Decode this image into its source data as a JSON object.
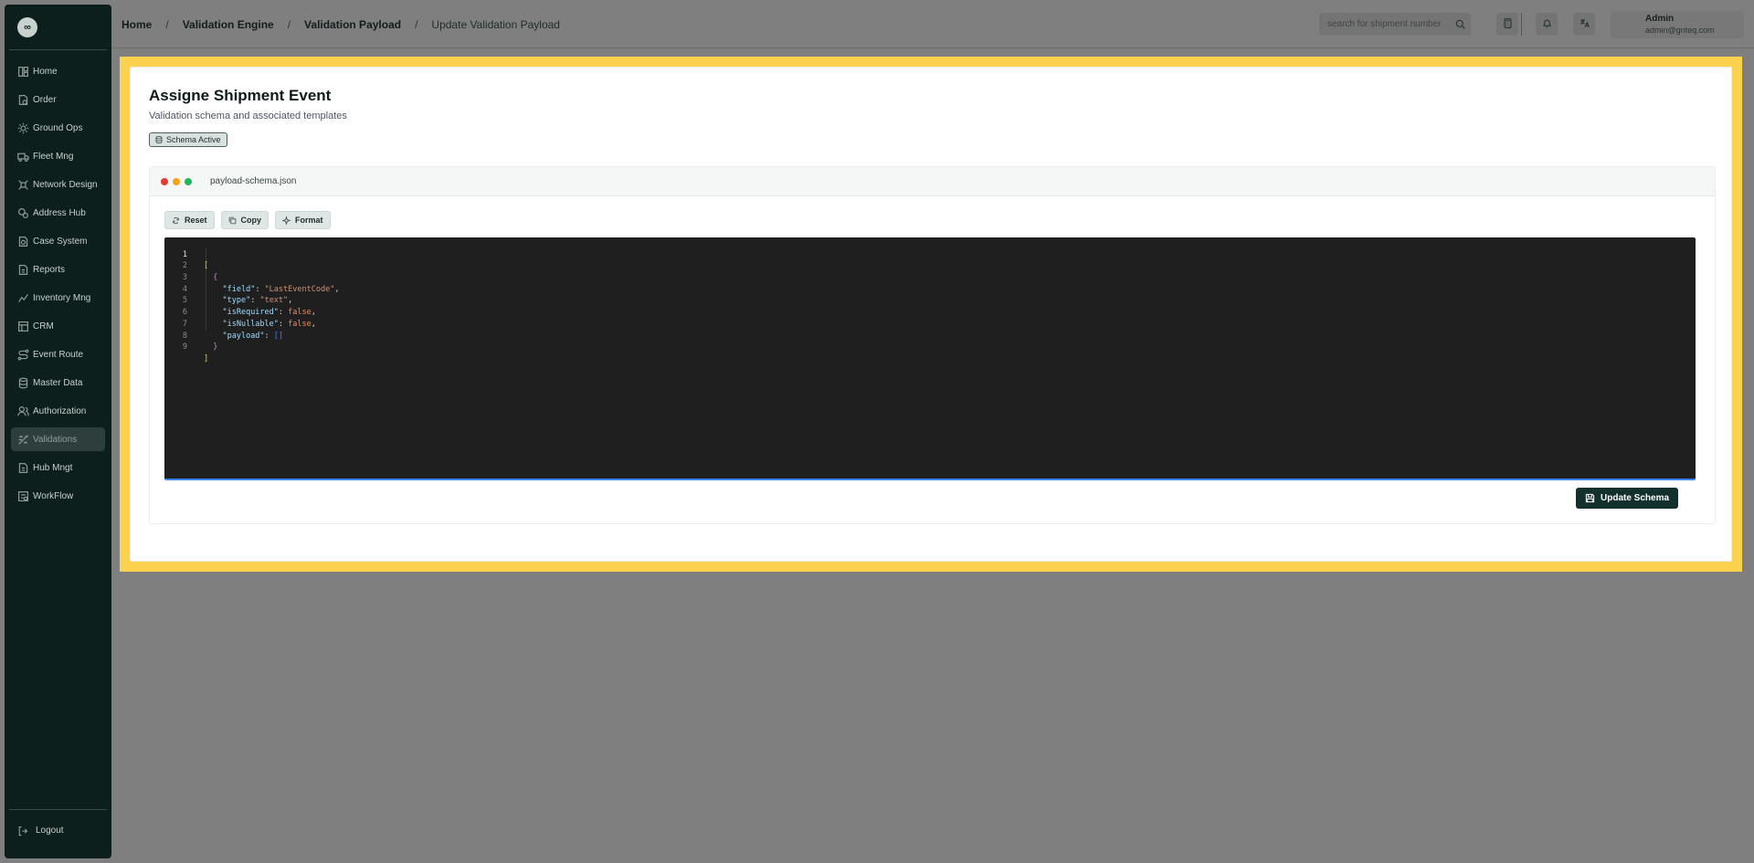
{
  "sidebar": {
    "logo_text": "∞",
    "items": [
      {
        "label": "Home",
        "icon": "dashboard-icon"
      },
      {
        "label": "Order",
        "icon": "order-icon"
      },
      {
        "label": "Ground Ops",
        "icon": "ground-ops-icon"
      },
      {
        "label": "Fleet Mng",
        "icon": "truck-icon"
      },
      {
        "label": "Network Design",
        "icon": "network-icon"
      },
      {
        "label": "Address Hub",
        "icon": "map-pin-icon"
      },
      {
        "label": "Case System",
        "icon": "case-icon"
      },
      {
        "label": "Reports",
        "icon": "reports-icon"
      },
      {
        "label": "Inventory Mng",
        "icon": "inventory-icon"
      },
      {
        "label": "CRM",
        "icon": "crm-icon"
      },
      {
        "label": "Event Route",
        "icon": "route-icon"
      },
      {
        "label": "Master Data",
        "icon": "database-icon"
      },
      {
        "label": "Authorization",
        "icon": "users-icon"
      },
      {
        "label": "Validations",
        "icon": "validation-icon",
        "active": true
      },
      {
        "label": "Hub Mngt",
        "icon": "hub-icon"
      },
      {
        "label": "WorkFlow",
        "icon": "workflow-icon"
      }
    ],
    "logout_label": "Logout"
  },
  "topbar": {
    "breadcrumb": [
      "Home",
      "Validation Engine",
      "Validation Payload",
      "Update Validation Payload"
    ],
    "search_placeholder": "search for shipment number",
    "user": {
      "name": "Admin",
      "email": "admin@gnteq.com"
    }
  },
  "main": {
    "title": "Assigne Shipment Event",
    "subtitle": "Validation schema and associated templates",
    "badge": "Schema Active",
    "editor": {
      "filename": "payload-schema.json",
      "buttons": {
        "reset": "Reset",
        "copy": "Copy",
        "format": "Format"
      },
      "line_numbers": [
        "1",
        "2",
        "3",
        "4",
        "5",
        "6",
        "7",
        "8",
        "9"
      ],
      "code": {
        "l1": "[",
        "l2": "{",
        "field_key": "\"field\"",
        "field_val": "\"LastEventCode\"",
        "type_key": "\"type\"",
        "type_val": "\"text\"",
        "req_key": "\"isRequired\"",
        "req_val": "false",
        "null_key": "\"isNullable\"",
        "null_val": "false",
        "payload_key": "\"payload\"",
        "payload_val": "[]",
        "l8": "}",
        "l9": "]"
      }
    },
    "update_button": "Update Schema"
  },
  "colors": {
    "sidebar_bg": "#0d1f1d",
    "highlight": "#fbd24e",
    "primary_button": "#12302d",
    "editor_bg": "#1f1f1f"
  }
}
